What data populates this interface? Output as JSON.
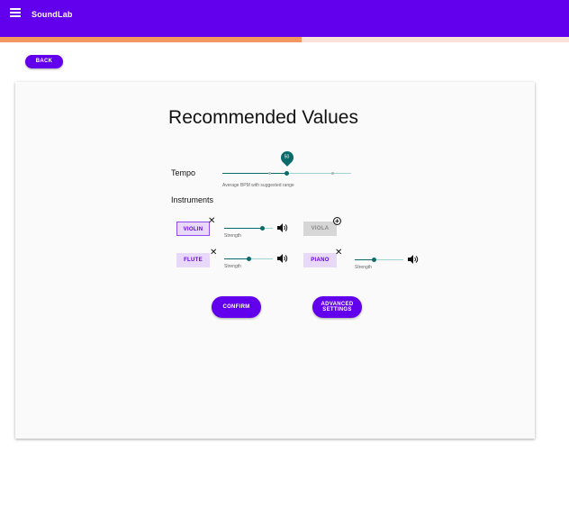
{
  "app": {
    "title": "SoundLab"
  },
  "progress": {
    "fraction": 0.53
  },
  "nav": {
    "back_label": "BACK"
  },
  "card": {
    "title": "Recommended Values",
    "tempo": {
      "label": "Tempo",
      "value": "50",
      "value_fraction": 0.5,
      "range_low_fraction": 0.37,
      "range_high_fraction": 0.86,
      "hint": "Average BPM with suggested range"
    },
    "instruments": {
      "label": "Instruments",
      "items": [
        {
          "name": "VIOLIN",
          "strength_label": "Strength",
          "strength": 0.78,
          "state": "active",
          "action": "remove"
        },
        {
          "name": "VIOLA",
          "strength_label": "",
          "strength": null,
          "state": "disabled",
          "action": "add"
        },
        {
          "name": "FLUTE",
          "strength_label": "Strength",
          "strength": 0.5,
          "state": "plain",
          "action": "remove"
        },
        {
          "name": "PIANO",
          "strength_label": "Strength",
          "strength": 0.4,
          "state": "plain",
          "action": "remove"
        }
      ]
    },
    "buttons": {
      "confirm_label": "CONFIRM",
      "advanced_line1": "ADVANCED",
      "advanced_line2": "SETTINGS"
    }
  },
  "colors": {
    "primary": "#6200ee",
    "teal": "#0b6b6b",
    "progress": "#f49660",
    "chip_bg": "#e8d9fb"
  },
  "icons": {
    "menu": "hamburger-icon",
    "remove": "close-icon",
    "add": "add-circle-icon",
    "volume": "volume-icon"
  }
}
